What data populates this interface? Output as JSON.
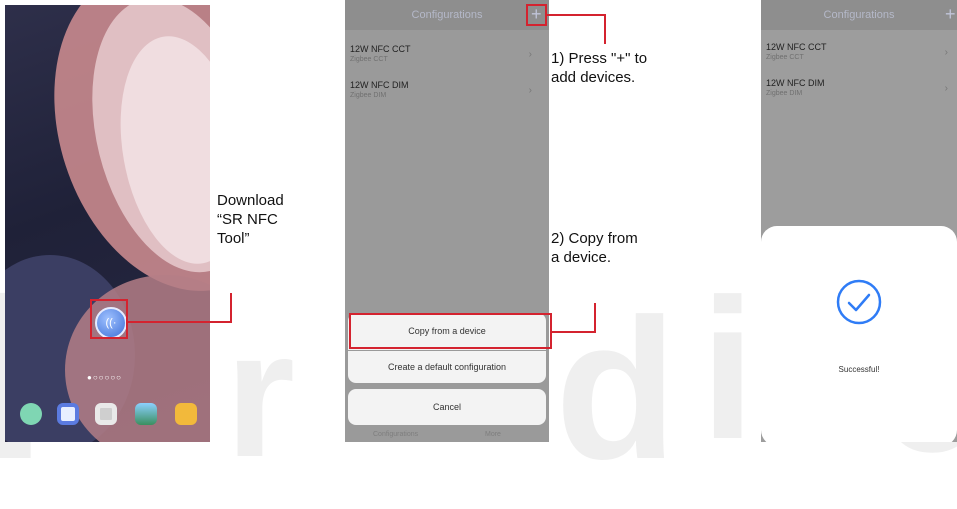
{
  "panel1": {
    "app_icon": "nfc-icon",
    "annotation": [
      "Download",
      "“SR NFC",
      "Tool”"
    ]
  },
  "panel2": {
    "nav_title": "Configurations",
    "add_button": "+",
    "items": [
      {
        "name": "12W NFC CCT",
        "sub": "Zigbee CCT"
      },
      {
        "name": "12W NFC DIM",
        "sub": "Zigbee DIM"
      }
    ],
    "sheet": {
      "copy": "Copy from a device",
      "create": "Create a default configuration",
      "cancel": "Cancel"
    },
    "tabs": [
      "Configurations",
      "More"
    ],
    "annotation_1": [
      "1) Press \"+\" to",
      "add devices."
    ],
    "annotation_2": [
      "2) Copy from",
      "a device."
    ]
  },
  "panel3": {
    "nav_title": "Configurations",
    "add_button": "+",
    "items": [
      {
        "name": "12W NFC CCT",
        "sub": "Zigbee CCT"
      },
      {
        "name": "12W NFC DIM",
        "sub": "Zigbee DIM"
      }
    ],
    "success_text": "Successful!",
    "success_icon": "check-circle-icon"
  },
  "colors": {
    "accent": "#d4232f",
    "check": "#2f7cf6"
  }
}
